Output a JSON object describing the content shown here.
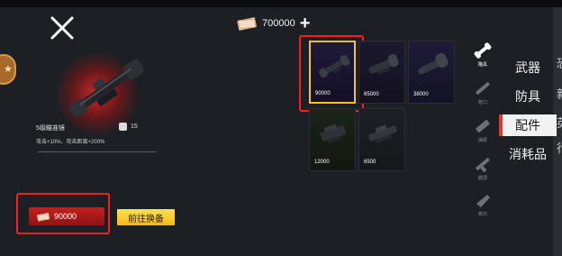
{
  "currency": {
    "amount": "700000",
    "plus": "+"
  },
  "selected_item": {
    "name": "5级瞄准镜",
    "weight": "15",
    "stats": "攻击+10%、攻击距离+200%",
    "price": "90000"
  },
  "buttons": {
    "equip": "前往换备"
  },
  "grid": [
    {
      "price": "90000",
      "selected": true
    },
    {
      "price": "65000",
      "selected": false
    },
    {
      "price": "38000",
      "selected": false
    },
    {
      "price": "12000",
      "selected": false
    },
    {
      "price": "6500",
      "selected": false
    }
  ],
  "subcategories": [
    {
      "label": "瞄具",
      "active": true
    },
    {
      "label": "枪口",
      "active": false
    },
    {
      "label": "弹匣",
      "active": false
    },
    {
      "label": "握把",
      "active": false
    },
    {
      "label": "枪托",
      "active": false
    }
  ],
  "categories": [
    {
      "label": "武器",
      "active": false
    },
    {
      "label": "防具",
      "active": false
    },
    {
      "label": "配件",
      "active": true
    },
    {
      "label": "消耗品",
      "active": false
    }
  ],
  "edge_chars": [
    "恐",
    "新",
    "英",
    "行"
  ],
  "colors": {
    "accent_red": "#ff1e1e",
    "equip_yellow": "#f5b919",
    "selected_gold": "#f0c430",
    "price_red": "#c51f1f"
  }
}
